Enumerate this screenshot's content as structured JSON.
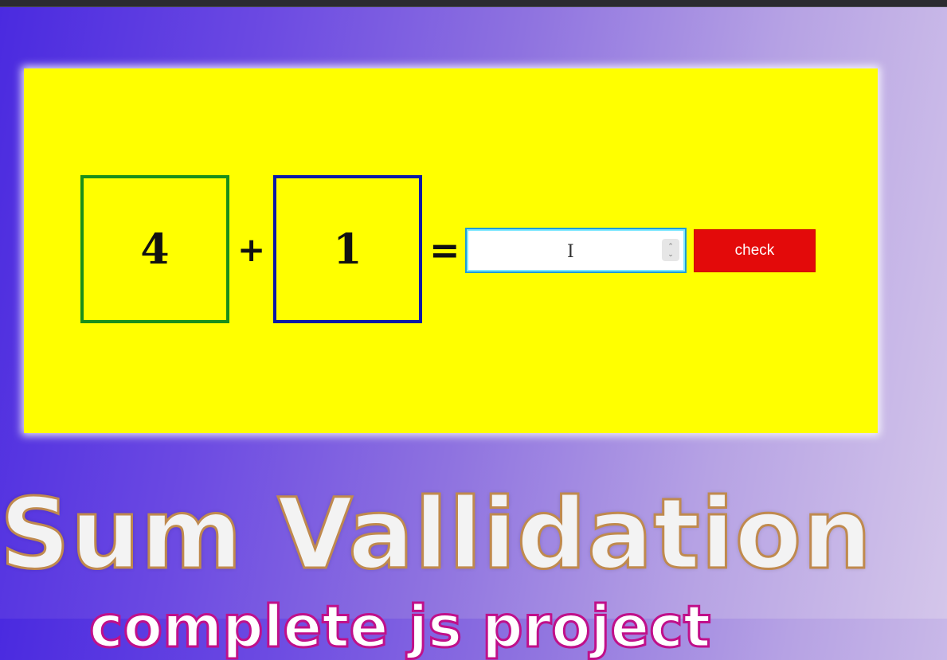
{
  "equation": {
    "first_number": "4",
    "operator": "+",
    "second_number": "1",
    "equals": "=",
    "answer_value": "",
    "check_label": "check"
  },
  "overlay": {
    "title": "Sum Vallidation",
    "subtitle": "complete js project"
  },
  "colors": {
    "panel": "#ffff00",
    "first_box_border": "#1a8f1a",
    "second_box_border": "#0a1aa6",
    "check_button": "#e30a0a"
  }
}
